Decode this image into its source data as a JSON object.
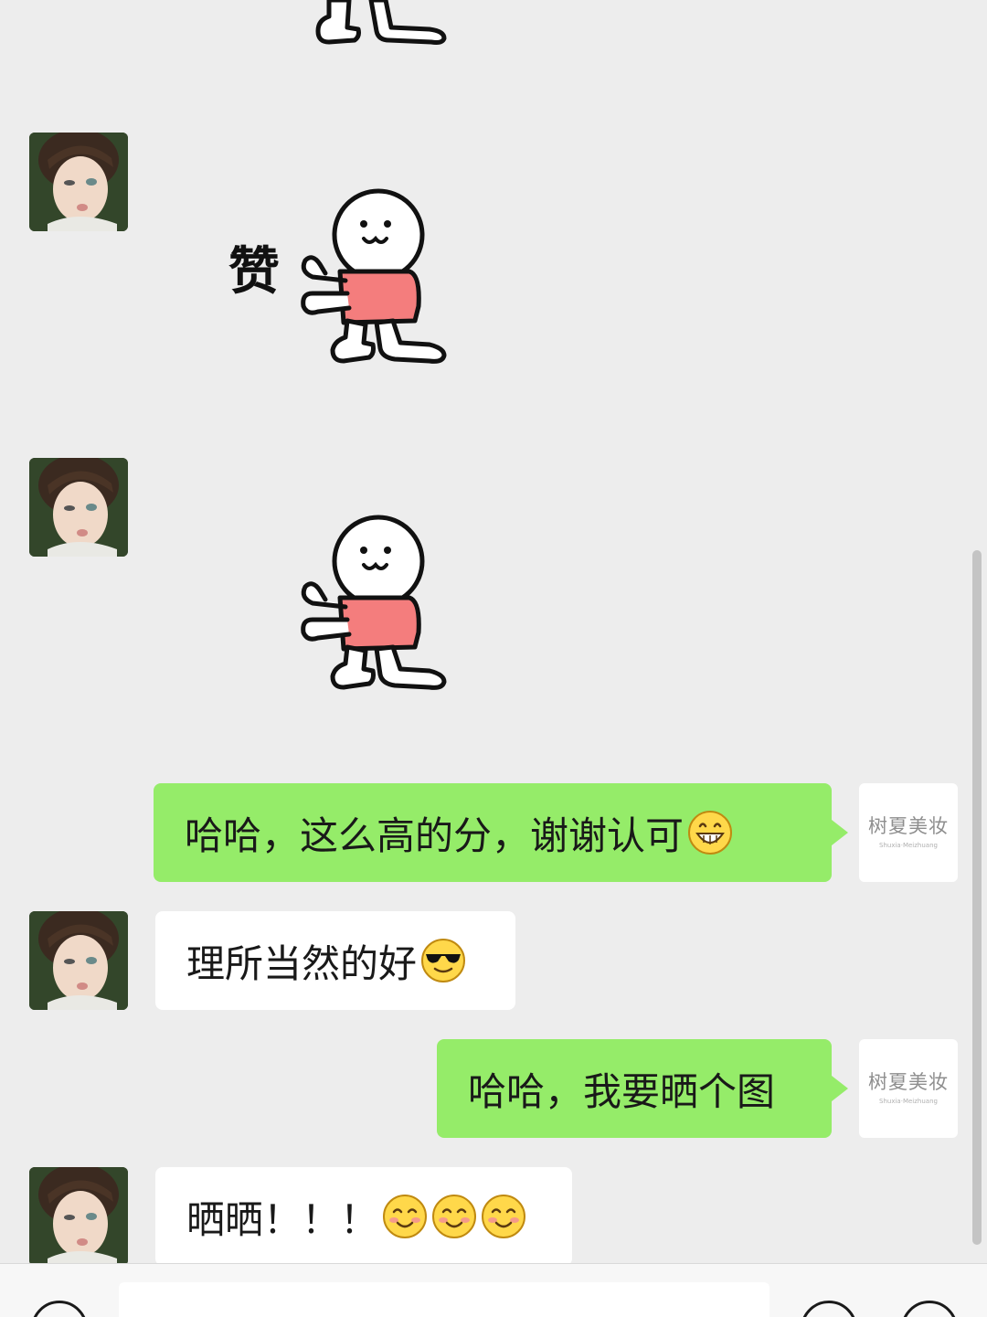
{
  "messages": {
    "sticker_zan_text": "赞",
    "msg_right_1": "哈哈，这么高的分，谢谢认可",
    "msg_left_1": "理所当然的好",
    "msg_right_2": "哈哈，我要晒个图",
    "msg_left_2": "晒晒！！！"
  },
  "brand_avatar": {
    "name": "树夏美妆",
    "sub": "Shuxia·Meizhuang"
  },
  "colors": {
    "background": "#ededed",
    "outgoing_bubble": "#95ec69",
    "incoming_bubble": "#ffffff",
    "sticker_shirt": "#f47d7d"
  },
  "icons": {
    "emoji_1": "grinning-emoji",
    "emoji_2": "sunglasses-emoji",
    "emoji_3": "blush-emoji"
  }
}
